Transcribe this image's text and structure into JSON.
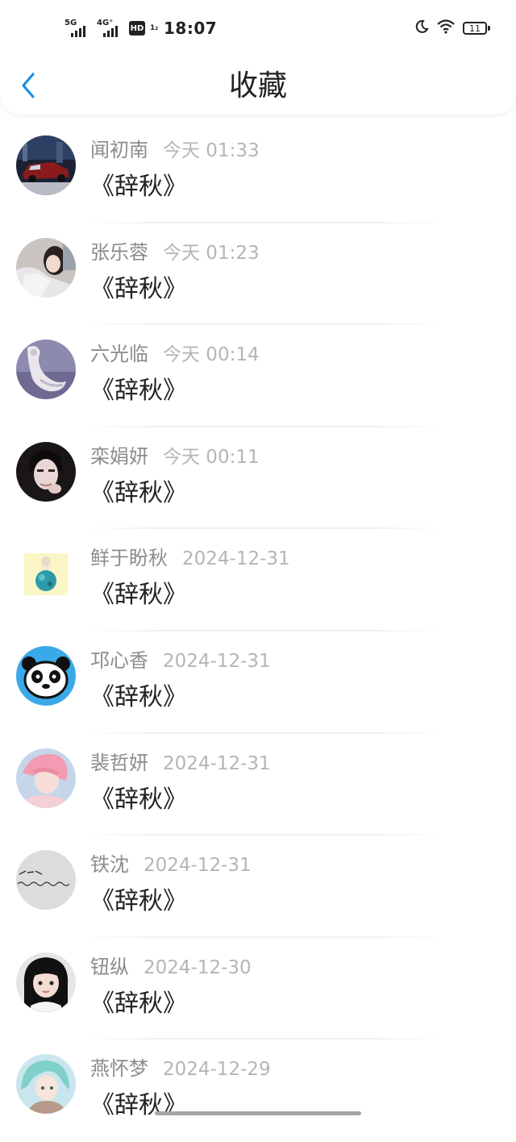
{
  "status_bar": {
    "network_1": "5G",
    "network_2": "4G⁺",
    "hd_label": "HD",
    "hd_index": "1₂",
    "time": "18:07",
    "battery": "11"
  },
  "header": {
    "title": "收藏"
  },
  "items": [
    {
      "name": "闻初南",
      "time": "今天 01:33",
      "content": "《辞秋》",
      "avatar": "avatar-car"
    },
    {
      "name": "张乐蓉",
      "time": "今天 01:23",
      "content": "《辞秋》",
      "avatar": "avatar-girl-light"
    },
    {
      "name": "六光临",
      "time": "今天 00:14",
      "content": "《辞秋》",
      "avatar": "avatar-sculpture"
    },
    {
      "name": "栾娟妍",
      "time": "今天 00:11",
      "content": "《辞秋》",
      "avatar": "avatar-boy-dark"
    },
    {
      "name": "鲜于盼秋",
      "time": "2024-12-31",
      "content": "《辞秋》",
      "avatar": "avatar-illustration"
    },
    {
      "name": "邛心香",
      "time": "2024-12-31",
      "content": "《辞秋》",
      "avatar": "avatar-panda"
    },
    {
      "name": "裴哲妍",
      "time": "2024-12-31",
      "content": "《辞秋》",
      "avatar": "avatar-pink-hair"
    },
    {
      "name": "铁沈",
      "time": "2024-12-31",
      "content": "《辞秋》",
      "avatar": "avatar-handwriting"
    },
    {
      "name": "钮纵",
      "time": "2024-12-30",
      "content": "《辞秋》",
      "avatar": "avatar-child"
    },
    {
      "name": "燕怀梦",
      "time": "2024-12-29",
      "content": "《辞秋》",
      "avatar": "avatar-anime"
    }
  ],
  "colors": {
    "accent": "#1a90e6",
    "name": "#8c8c8c",
    "time": "#b5b5b5",
    "content": "#222222"
  }
}
